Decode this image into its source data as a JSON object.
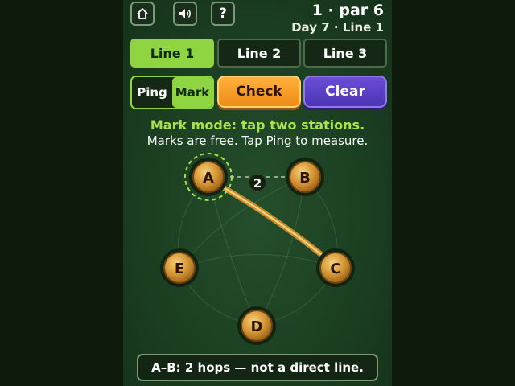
{
  "header": {
    "home_icon": "home-icon",
    "sound_icon": "speaker-icon",
    "help_label": "?",
    "par_text": "1 · par 6",
    "day_text": "Day 7 · Line 1"
  },
  "tabs": [
    {
      "label": "Line 1",
      "active": true
    },
    {
      "label": "Line 2",
      "active": false
    },
    {
      "label": "Line 3",
      "active": false
    }
  ],
  "controls": {
    "ping_label": "Ping",
    "mark_label": "Mark",
    "mode_selected": "Mark",
    "check_label": "Check",
    "clear_label": "Clear"
  },
  "messages": {
    "mode": "Mark mode: tap two stations.",
    "hint": "Marks are free. Tap Ping to measure."
  },
  "board": {
    "stations": [
      "A",
      "B",
      "C",
      "D",
      "E"
    ],
    "selected_station": "A",
    "ping_badge": "2",
    "ping_pair": [
      "A",
      "B"
    ],
    "drawn_line": [
      "A",
      "C"
    ]
  },
  "status": "A–B: 2 hops — not a direct line.",
  "colors": {
    "accent_green": "#8fd542",
    "check_orange": "#f5961f",
    "clear_purple": "#5a40c6",
    "station_gold": "#c98a2c"
  }
}
